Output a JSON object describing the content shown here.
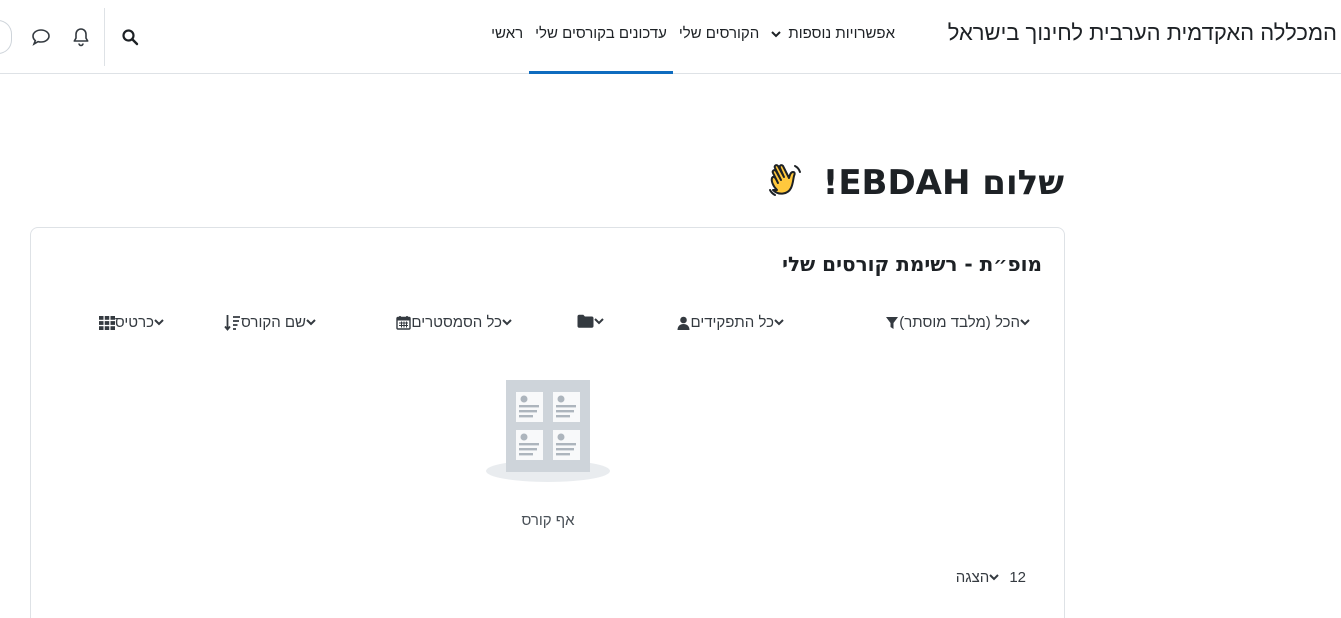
{
  "navbar": {
    "brand": "המכללה האקדמית הערבית לחינוך בישראל",
    "links": {
      "home": "ראשי",
      "dashboard": "עדכונים בקורסים שלי",
      "mycourses": "הקורסים שלי",
      "more": "אפשרויות נוספות"
    },
    "active": "dashboard",
    "accent_color": "#0f6cbf",
    "icons": [
      "search-icon",
      "bell-icon",
      "message-icon"
    ]
  },
  "greeting": {
    "text": "שלום EBDAH!",
    "emoji": "waving-hand-icon"
  },
  "course_overview": {
    "title": "מופ״ת - רשימת קורסים שלי",
    "filters": {
      "grouping": "הכל (מלבד מוסתר)",
      "roles": "כל התפקידים",
      "semesters": "כל הסמסטרים",
      "sort": "שם הקורס",
      "view": "כרטיס"
    },
    "empty_text": "אף קורס",
    "paging": {
      "label": "הצגה",
      "value": "12"
    }
  }
}
